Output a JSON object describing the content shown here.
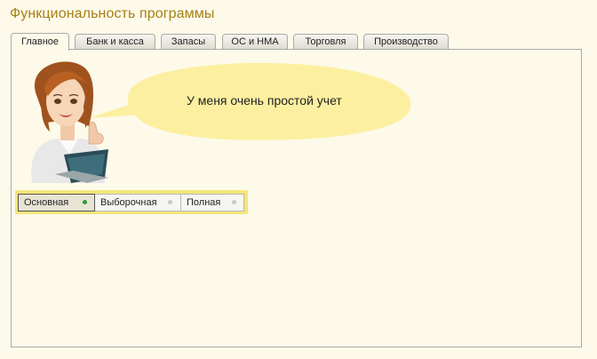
{
  "title": "Функциональность программы",
  "tabs": [
    {
      "label": "Главное"
    },
    {
      "label": "Банк и касса"
    },
    {
      "label": "Запасы"
    },
    {
      "label": "ОС и НМА"
    },
    {
      "label": "Торговля"
    },
    {
      "label": "Производство"
    }
  ],
  "bubble_text": "У меня очень простой учет",
  "modes": [
    {
      "label": "Основная",
      "selected": true
    },
    {
      "label": "Выборочная",
      "selected": false
    },
    {
      "label": "Полная",
      "selected": false
    }
  ],
  "colors": {
    "title": "#a78013",
    "background": "#fdfaea",
    "bubble": "#fcefa0",
    "switch_highlight": "#f5e57a",
    "selected_dot": "#2f9a2f"
  }
}
